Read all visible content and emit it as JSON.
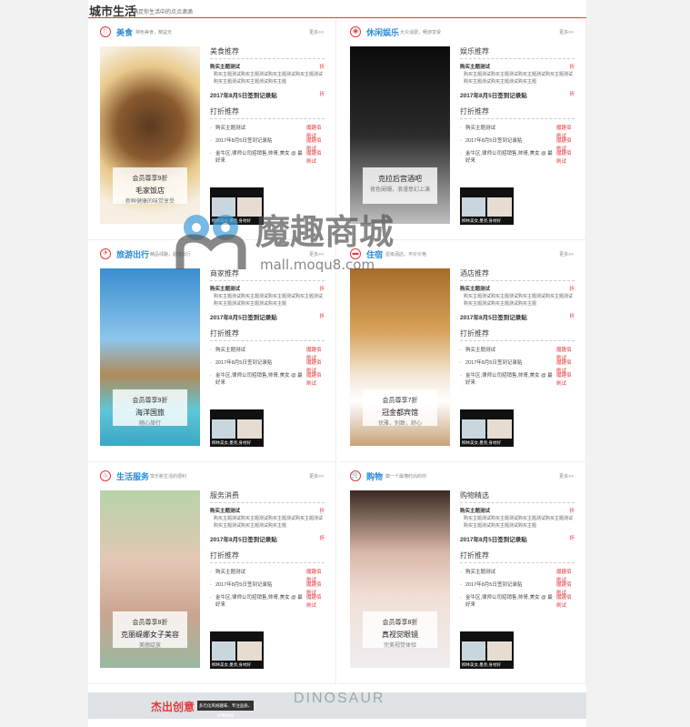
{
  "header": {
    "title": "城市生活",
    "subtitle": "满足你生活中的点点滴滴"
  },
  "colors": {
    "accent": "#e4393c",
    "link": "#2a8ad6"
  },
  "cells": [
    {
      "icon": "fork-knife-icon",
      "glyph": "🍴",
      "cat": "美食",
      "catsub": "特色美食，精益天",
      "more": "更多>>",
      "caption": {
        "c1": "会员尊享9折",
        "c2": "毛家饭店",
        "c3": "新鲜健康的味觉享受"
      },
      "info_h": "美食推荐"
    },
    {
      "icon": "cup-icon",
      "glyph": "◉",
      "cat": "休闲娱乐",
      "catsub": "大众消费，畅游享受",
      "more": "更多>>",
      "caption": {
        "c1": "",
        "c2": "克拉后宫酒吧",
        "c3": "夜色阑珊，浪漫意幻上演"
      },
      "info_h": "娱乐推荐"
    },
    {
      "icon": "plane-icon",
      "glyph": "✈",
      "cat": "旅游出行",
      "catsub": "精品线路，超值出行",
      "more": "更多>>",
      "caption": {
        "c1": "会员尊享9折",
        "c2": "海洋国旅",
        "c3": "随心旅行"
      },
      "info_h": "商家推荐"
    },
    {
      "icon": "bed-icon",
      "glyph": "▬",
      "cat": "住宿",
      "catsub": "星级酒店，平价价格",
      "more": "更多>>",
      "caption": {
        "c1": "会员尊享7折",
        "c2": "冠金都宾馆",
        "c3": "优雅，别致，舒心"
      },
      "info_h": "酒店推荐"
    },
    {
      "icon": "service-icon",
      "glyph": "♨",
      "cat": "生活服务",
      "catsub": "享乐新生活的便利",
      "more": "更多>>",
      "caption": {
        "c1": "会员尊享8折",
        "c2": "克丽缇娜女子美容",
        "c3": "美丽绽放"
      },
      "info_h": "服务消费"
    },
    {
      "icon": "cart-icon",
      "glyph": "🛒",
      "cat": "购物",
      "catsub": "做一个最懂时尚的你",
      "more": "更多>>",
      "caption": {
        "c1": "会员尊享8折",
        "c2": "真视觉眼镜",
        "c3": "完美视觉体验"
      },
      "info_h": "购物精选"
    }
  ],
  "info": {
    "row": "购买主题测试",
    "row_tag": "折",
    "desc": "购买主题测试购买主题测试购买主题测试购买主题测试购买主题测试购买主题测试购买主题",
    "date": "2017年8月5日签到记录贴",
    "date_tag": "折",
    "h2": "打折推荐",
    "items": [
      {
        "text": "购买主题测试",
        "tag": "魔趣佰刷试"
      },
      {
        "text": "2017年8月5日签到记录贴",
        "tag": "魔趣佰刷试"
      },
      {
        "text": "金牛区,律师公司招销售,帅哥,美女 @ 最好来",
        "tag": "魔趣佰刷试"
      }
    ],
    "thumb_label": "柳林美女,墨亮,身材好"
  },
  "watermark": {
    "name": "魔趣商城",
    "url": "mall.moqu8.com"
  },
  "banner": {
    "title": "杰出创意",
    "tag": "多元化风格趣味、专注品质、办事快捷",
    "brand": "DINOSAUR"
  }
}
